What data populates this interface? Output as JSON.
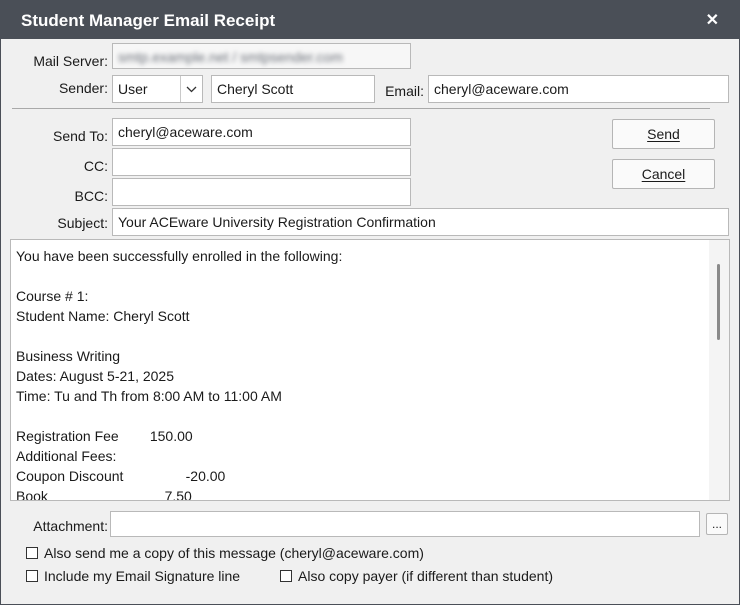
{
  "window": {
    "title": "Student Manager Email Receipt",
    "close_glyph": "✕"
  },
  "form": {
    "mail_server_label": "Mail Server:",
    "mail_server_value": "smtp.example.net / smtpsender.com",
    "sender_label": "Sender:",
    "sender_type": "User",
    "sender_name": "Cheryl Scott",
    "email_label": "Email:",
    "sender_email": "cheryl@aceware.com",
    "send_to_label": "Send To:",
    "send_to_value": "cheryl@aceware.com",
    "cc_label": "CC:",
    "cc_value": "",
    "bcc_label": "BCC:",
    "bcc_value": "",
    "subject_label": "Subject:",
    "subject_value": "Your ACEware University Registration Confirmation",
    "attachment_label": "Attachment:",
    "attachment_value": "",
    "browse_label": "..."
  },
  "buttons": {
    "send": "Send",
    "cancel": "Cancel"
  },
  "message_body": "You have been successfully enrolled in the following:\n\nCourse # 1:\nStudent Name: Cheryl Scott\n\nBusiness Writing\nDates: August 5-21, 2025\nTime: Tu and Th from 8:00 AM to 11:00 AM\n\nRegistration Fee        150.00\nAdditional Fees:\nCoupon Discount                -20.00\nBook                              7.50",
  "options": {
    "copy_me": "Also send me a copy of this message (cheryl@aceware.com)",
    "signature": "Include my Email Signature line",
    "copy_payer": "Also copy payer (if different than student)"
  },
  "colors": {
    "titlebar": "#4a4f57",
    "window_bg": "#f0f0f0"
  }
}
